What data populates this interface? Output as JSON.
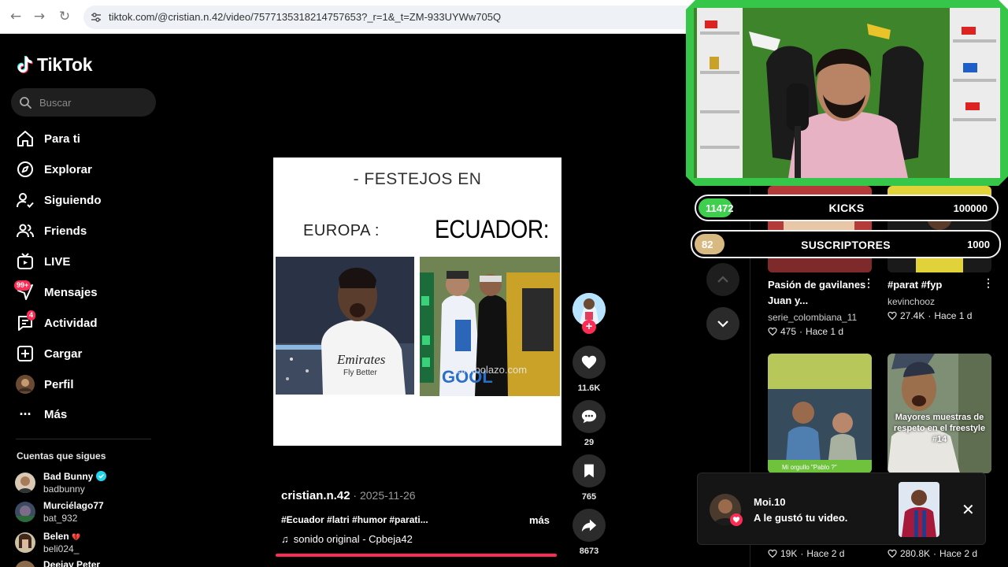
{
  "browser": {
    "url": "tiktok.com/@cristian.n.42/video/7577135318214757653?_r=1&_t=ZM-933UYWw705Q",
    "back_glyph": "←",
    "forward_glyph": "→",
    "reload_glyph": "↻"
  },
  "sidebar": {
    "logo_text": "TikTok",
    "search_placeholder": "Buscar",
    "items": [
      {
        "label": "Para ti",
        "icon": "home-icon"
      },
      {
        "label": "Explorar",
        "icon": "compass-icon"
      },
      {
        "label": "Siguiendo",
        "icon": "user-check-icon"
      },
      {
        "label": "Friends",
        "icon": "users-icon"
      },
      {
        "label": "LIVE",
        "icon": "live-tv-icon"
      },
      {
        "label": "Mensajes",
        "icon": "send-icon",
        "badge": "99+"
      },
      {
        "label": "Actividad",
        "icon": "activity-icon",
        "badge": "4"
      },
      {
        "label": "Cargar",
        "icon": "upload-icon"
      },
      {
        "label": "Perfil",
        "icon": "avatar"
      },
      {
        "label": "Más",
        "icon": "more-icon",
        "glyph": "···"
      }
    ],
    "following_title": "Cuentas que sigues",
    "following": [
      {
        "name": "Bad Bunny",
        "handle": "badbunny",
        "verified": true
      },
      {
        "name": "Murciélago77",
        "handle": "bat_932"
      },
      {
        "name": "Belen",
        "handle": "beli024_",
        "emoji": "💔"
      },
      {
        "name": "Deejay Peter",
        "handle": ""
      }
    ]
  },
  "video": {
    "title": "- FESTEJOS EN",
    "left_label": "EUROPA :",
    "right_label": "ECUADOR:",
    "watermark": "elfutbolazo.com",
    "jersey_text": "Emirates",
    "author": "cristian.n.42",
    "date": " · 2025-11-26",
    "tags": "#Ecuador #latri #humor #parati...",
    "more": "más",
    "sound": "sonido original - Cpbeja42",
    "sound_glyph": "♫"
  },
  "actions": {
    "likes": "11.6K",
    "comments": "29",
    "saves": "765",
    "shares": "8673",
    "follow_glyph": "+"
  },
  "stream": {
    "kicks_current": "11472",
    "kicks_label": "KICKS",
    "kicks_goal": "100000",
    "kicks_progress": 0.115,
    "subs_current": "82",
    "subs_label": "SUSCRIPTORES",
    "subs_goal": "1000",
    "subs_progress": 0.082
  },
  "grid": [
    {
      "title": "Pasión de gavilanes Juan y...",
      "user": "serie_colombiana_11",
      "likes": "475",
      "age": "Hace 1 d"
    },
    {
      "title": "#parat #fyp",
      "user": "kevinchooz",
      "likes": "27.4K",
      "age": "Hace 1 d"
    },
    {
      "overlay": "Mi orgullo \"Pablo ?\"",
      "likes": "19K",
      "age": "Hace 2 d"
    },
    {
      "overlay": "Mayores muestras de respeto en el freestyle #14",
      "likes": "280.8K",
      "age": "Hace 2 d"
    }
  ],
  "grid_sep": " · ",
  "kebab_glyph": "⋮",
  "toast": {
    "name": "Moi.10",
    "message": "A le gustó tu video.",
    "close_glyph": "✕"
  },
  "colors": {
    "brand_pink": "#fe2c55",
    "stream_green": "#35c64a",
    "kicks_fill": "#3fcf4f",
    "subs_fill": "#d9b982"
  }
}
